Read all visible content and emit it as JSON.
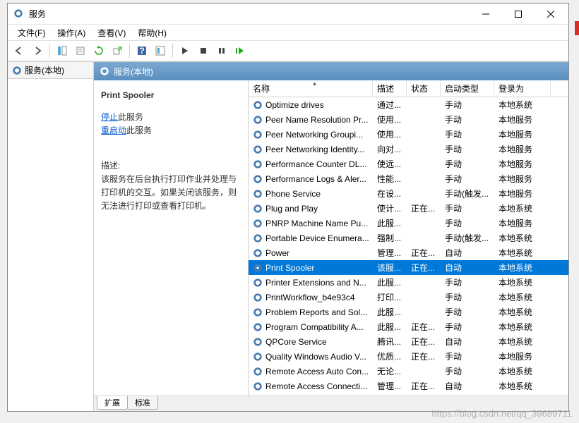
{
  "window": {
    "title": "服务"
  },
  "menu": {
    "file": "文件(F)",
    "action": "操作(A)",
    "view": "查看(V)",
    "help": "帮助(H)"
  },
  "side": {
    "node": "服务(本地)"
  },
  "mainHead": "服务(本地)",
  "detail": {
    "name": "Print Spooler",
    "stop": "停止",
    "stopSuffix": "此服务",
    "restart": "重启动",
    "restartSuffix": "此服务",
    "descLabel": "描述:",
    "desc": "该服务在后台执行打印作业并处理与打印机的交互。如果关闭该服务，则无法进行打印或查看打印机。"
  },
  "cols": {
    "name": "名称",
    "desc": "描述",
    "status": "状态",
    "start": "启动类型",
    "logon": "登录为"
  },
  "tabs": {
    "ext": "扩展",
    "std": "标准"
  },
  "services": [
    {
      "n": "Optimize drives",
      "d": "通过...",
      "s": "",
      "t": "手动",
      "l": "本地系统"
    },
    {
      "n": "Peer Name Resolution Pr...",
      "d": "使用...",
      "s": "",
      "t": "手动",
      "l": "本地服务"
    },
    {
      "n": "Peer Networking Groupi...",
      "d": "使用...",
      "s": "",
      "t": "手动",
      "l": "本地服务"
    },
    {
      "n": "Peer Networking Identity...",
      "d": "向对...",
      "s": "",
      "t": "手动",
      "l": "本地服务"
    },
    {
      "n": "Performance Counter DL...",
      "d": "使远...",
      "s": "",
      "t": "手动",
      "l": "本地服务"
    },
    {
      "n": "Performance Logs & Aler...",
      "d": "性能...",
      "s": "",
      "t": "手动",
      "l": "本地服务"
    },
    {
      "n": "Phone Service",
      "d": "在设...",
      "s": "",
      "t": "手动(触发...",
      "l": "本地服务"
    },
    {
      "n": "Plug and Play",
      "d": "使计...",
      "s": "正在...",
      "t": "手动",
      "l": "本地系统"
    },
    {
      "n": "PNRP Machine Name Pu...",
      "d": "此服...",
      "s": "",
      "t": "手动",
      "l": "本地服务"
    },
    {
      "n": "Portable Device Enumera...",
      "d": "强制...",
      "s": "",
      "t": "手动(触发...",
      "l": "本地系统"
    },
    {
      "n": "Power",
      "d": "管理...",
      "s": "正在...",
      "t": "自动",
      "l": "本地系统"
    },
    {
      "n": "Print Spooler",
      "d": "该服...",
      "s": "正在...",
      "t": "自动",
      "l": "本地系统",
      "sel": true
    },
    {
      "n": "Printer Extensions and N...",
      "d": "此服...",
      "s": "",
      "t": "手动",
      "l": "本地系统"
    },
    {
      "n": "PrintWorkflow_b4e93c4",
      "d": "打印...",
      "s": "",
      "t": "手动",
      "l": "本地系统"
    },
    {
      "n": "Problem Reports and Sol...",
      "d": "此服...",
      "s": "",
      "t": "手动",
      "l": "本地系统"
    },
    {
      "n": "Program Compatibility A...",
      "d": "此服...",
      "s": "正在...",
      "t": "手动",
      "l": "本地系统"
    },
    {
      "n": "QPCore Service",
      "d": "腾讯...",
      "s": "正在...",
      "t": "自动",
      "l": "本地系统"
    },
    {
      "n": "Quality Windows Audio V...",
      "d": "优质...",
      "s": "正在...",
      "t": "手动",
      "l": "本地服务"
    },
    {
      "n": "Remote Access Auto Con...",
      "d": "无论...",
      "s": "",
      "t": "手动",
      "l": "本地系统"
    },
    {
      "n": "Remote Access Connecti...",
      "d": "管理...",
      "s": "正在...",
      "t": "自动",
      "l": "本地系统"
    }
  ],
  "watermark": "https://blog.csdn.net/qq_39689711"
}
